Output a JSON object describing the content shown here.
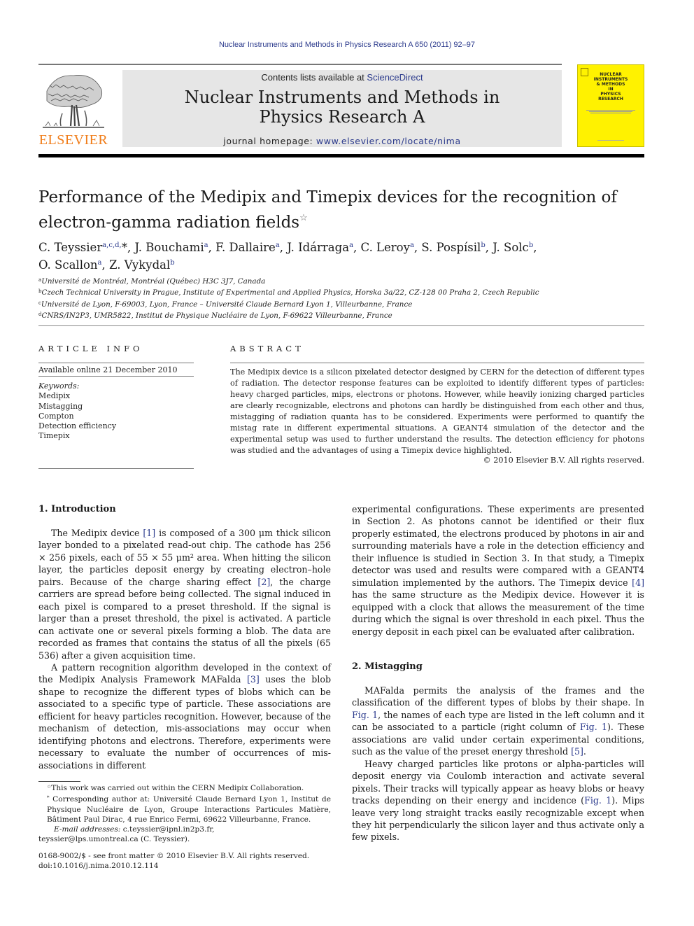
{
  "running_head": "Nuclear Instruments and Methods in Physics Research A 650 (2011) 92–97",
  "header": {
    "publisher": "ELSEVIER",
    "contents_prefix": "Contents lists available at ",
    "contents_link": "ScienceDirect",
    "journal_title_line1": "Nuclear Instruments and Methods in",
    "journal_title_line2": "Physics Research A",
    "homepage_prefix": "journal homepage: ",
    "homepage_link": "www.elsevier.com/locate/nima",
    "cover_title": [
      "NUCLEAR",
      "INSTRUMENTS",
      "& METHODS",
      "IN",
      "PHYSICS",
      "RESEARCH"
    ],
    "brand_color": "#f07d1a",
    "link_color": "#2b3a8c",
    "cover_color": "#fff200"
  },
  "article": {
    "title_line1": "Performance of the Medipix and Timepix devices for the recognition of",
    "title_line2": "electron-gamma radiation fields",
    "title_note": "☆",
    "authors": [
      {
        "name": "C. Teyssier",
        "aff": "a,c,d,",
        "mark": "*"
      },
      {
        "name": "J. Bouchami",
        "aff": "a"
      },
      {
        "name": "F. Dallaire",
        "aff": "a"
      },
      {
        "name": "J. Idárraga",
        "aff": "a"
      },
      {
        "name": "C. Leroy",
        "aff": "a"
      },
      {
        "name": "S. Pospísil",
        "aff": "b"
      },
      {
        "name": "J. Solc",
        "aff": "b"
      },
      {
        "name": "O. Scallon",
        "aff": "a"
      },
      {
        "name": "Z. Vykydal",
        "aff": "b"
      }
    ],
    "affiliations": [
      {
        "key": "a",
        "text": "Université de Montréal, Montréal (Québec) H3C 3J7, Canada"
      },
      {
        "key": "b",
        "text": "Czech Technical University in Prague, Institute of Experimental and Applied Physics, Horska 3a/22, CZ-128 00 Praha 2, Czech Republic"
      },
      {
        "key": "c",
        "text": "Université de Lyon, F-69003, Lyon, France – Université Claude Bernard Lyon 1, Villeurbanne, France"
      },
      {
        "key": "d",
        "text": "CNRS/IN2P3, UMR5822, Institut de Physique Nucléaire de Lyon, F-69622 Villeurbanne, France"
      }
    ]
  },
  "article_info": {
    "heading": "ARTICLE INFO",
    "available": "Available online 21 December 2010",
    "keywords_label": "Keywords:",
    "keywords": [
      "Medipix",
      "Mistagging",
      "Compton",
      "Detection efficiency",
      "Timepix"
    ]
  },
  "abstract": {
    "heading": "ABSTRACT",
    "text": "The Medipix device is a silicon pixelated detector designed by CERN for the detection of different types of radiation. The detector response features can be exploited to identify different types of particles: heavy charged particles, mips, electrons or photons. However, while heavily ionizing charged particles are clearly recognizable, electrons and photons can hardly be distinguished from each other and thus, mistagging of radiation quanta has to be considered. Experiments were performed to quantify the mistag rate in different experimental situations. A GEANT4 simulation of the detector and the experimental setup was used to further understand the results. The detection efficiency for photons was studied and the advantages of using a Timepix device highlighted.",
    "copyright": "© 2010 Elsevier B.V. All rights reserved."
  },
  "body": {
    "sec1_heading": "1.  Introduction",
    "p1_a": "The Medipix device ",
    "p1_ref1": "[1]",
    "p1_b": " is composed of a 300 μm thick silicon layer bonded to a pixelated read-out chip. The cathode has 256 × 256 pixels, each of 55 × 55 μm² area. When hitting the silicon layer, the particles deposit energy by creating electron–hole pairs. Because of the charge sharing effect ",
    "p1_ref2": "[2]",
    "p1_c": ", the charge carriers are spread before being collected. The signal induced in each pixel is compared to a preset threshold. If the signal is larger than a preset threshold, the pixel is activated. A particle can activate one or several pixels forming a blob. The data are recorded as frames that contains the status of all the pixels (65 536) after a given acquisition time.",
    "p2_a": "A pattern recognition algorithm developed in the context of the Medipix Analysis Framework MAFalda ",
    "p2_ref3": "[3]",
    "p2_b": " uses the blob shape to recognize the different types of blobs which can be associated to a specific type of particle. These associations are efficient for heavy particles recognition. However, because of the mechanism of detection, mis-associations may occur when identifying photons and electrons. Therefore, experiments were necessary to evaluate the number of occurrences of mis-associations in different",
    "p3_a": "experimental configurations. These experiments are presented in Section 2. As photons cannot be identified or their flux properly estimated, the electrons produced by photons in air and surrounding materials have a role in the detection efficiency and their influence is studied in Section 3. In that study, a Timepix detector was used and results were compared with a GEANT4 simulation implemented by the authors. The Timepix device ",
    "p3_ref4": "[4]",
    "p3_b": " has the same structure as the Medipix device. However it is equipped with a clock that allows the measurement of the time during which the signal is over threshold in each pixel. Thus the energy deposit in each pixel can be evaluated after calibration.",
    "sec2_heading": "2.  Mistagging",
    "p4_a": "MAFalda permits the analysis of the frames and the classification of the different types of blobs by their shape. In ",
    "p4_fig1a": "Fig. 1",
    "p4_b": ", the names of each type are listed in the left column and it can be associated to a particle (right column of ",
    "p4_fig1b": "Fig. 1",
    "p4_c": "). These associations are valid under certain experimental conditions, such as the value of the preset energy threshold ",
    "p4_ref5": "[5]",
    "p4_d": ".",
    "p5_a": "Heavy charged particles like protons or alpha-particles will deposit energy via Coulomb interaction and activate several pixels. Their tracks will typically appear as heavy blobs or heavy tracks depending on their energy and incidence (",
    "p5_fig1": "Fig. 1",
    "p5_b": "). Mips leave very long straight tracks easily recognizable except when they hit perpendicularly the silicon layer and thus activate only a few pixels."
  },
  "footnotes": {
    "note_mark": "☆",
    "note": "This work was carried out within the CERN Medipix Collaboration.",
    "corr_mark": "*",
    "corr": "Corresponding author at: Université Claude Bernard Lyon 1, Institut de Physique Nucléaire de Lyon, Groupe Interactions Particules Matière, Bâtiment Paul Dirac, 4 rue Enrico Fermi, 69622 Villeurbanne, France.",
    "email_label": "E-mail addresses:",
    "email1": "c.teyssier@ipnl.in2p3.fr,",
    "email2": "teyssier@lps.umontreal.ca (C. Teyssier).",
    "issn": "0168-9002/$ - see front matter © 2010 Elsevier B.V. All rights reserved.",
    "doi": "doi:10.1016/j.nima.2010.12.114"
  }
}
